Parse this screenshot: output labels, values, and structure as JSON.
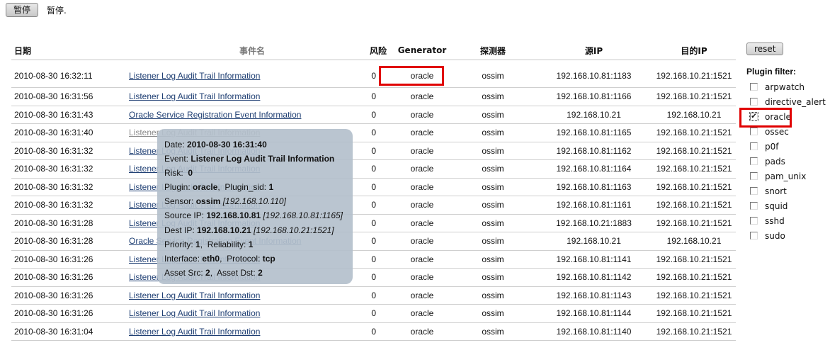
{
  "top": {
    "pause_button": "暂停",
    "pause_status": "暂停."
  },
  "table": {
    "headers": {
      "date": "日期",
      "event": "事件名",
      "risk": "风险",
      "generator": "Generator",
      "sensor": "探测器",
      "src_ip": "源IP",
      "dst_ip": "目的IP"
    },
    "rows": [
      {
        "date": "2010-08-30 16:32:11",
        "event": "Listener Log Audit Trail Information",
        "risk": "0",
        "generator": "oracle",
        "sensor": "ossim",
        "src": "192.168.10.81:1183",
        "dst": "192.168.10.21:1521"
      },
      {
        "date": "2010-08-30 16:31:56",
        "event": "Listener Log Audit Trail Information",
        "risk": "0",
        "generator": "oracle",
        "sensor": "ossim",
        "src": "192.168.10.81:1166",
        "dst": "192.168.10.21:1521"
      },
      {
        "date": "2010-08-30 16:31:43",
        "event": "Oracle Service Registration Event Information",
        "risk": "0",
        "generator": "oracle",
        "sensor": "ossim",
        "src": "192.168.10.21",
        "dst": "192.168.10.21"
      },
      {
        "date": "2010-08-30 16:31:40",
        "event": "Listener Log Audit Trail Information",
        "risk": "0",
        "generator": "oracle",
        "sensor": "ossim",
        "src": "192.168.10.81:1165",
        "dst": "192.168.10.21:1521"
      },
      {
        "date": "2010-08-30 16:31:32",
        "event": "Listener Log Audit Trail Information",
        "risk": "0",
        "generator": "oracle",
        "sensor": "ossim",
        "src": "192.168.10.81:1162",
        "dst": "192.168.10.21:1521"
      },
      {
        "date": "2010-08-30 16:31:32",
        "event": "Listener Log Audit Trail Information",
        "risk": "0",
        "generator": "oracle",
        "sensor": "ossim",
        "src": "192.168.10.81:1164",
        "dst": "192.168.10.21:1521"
      },
      {
        "date": "2010-08-30 16:31:32",
        "event": "Listener Log Audit Trail Information",
        "risk": "0",
        "generator": "oracle",
        "sensor": "ossim",
        "src": "192.168.10.81:1163",
        "dst": "192.168.10.21:1521"
      },
      {
        "date": "2010-08-30 16:31:32",
        "event": "Listener Log Audit Trail Information",
        "risk": "0",
        "generator": "oracle",
        "sensor": "ossim",
        "src": "192.168.10.81:1161",
        "dst": "192.168.10.21:1521"
      },
      {
        "date": "2010-08-30 16:31:28",
        "event": "Listener Log Audit Trail Information",
        "risk": "0",
        "generator": "oracle",
        "sensor": "ossim",
        "src": "192.168.10.21:1883",
        "dst": "192.168.10.21:1521"
      },
      {
        "date": "2010-08-30 16:31:28",
        "event": "Oracle Service Registration Event Information",
        "risk": "0",
        "generator": "oracle",
        "sensor": "ossim",
        "src": "192.168.10.21",
        "dst": "192.168.10.21"
      },
      {
        "date": "2010-08-30 16:31:26",
        "event": "Listener Log Audit Trail Information",
        "risk": "0",
        "generator": "oracle",
        "sensor": "ossim",
        "src": "192.168.10.81:1141",
        "dst": "192.168.10.21:1521"
      },
      {
        "date": "2010-08-30 16:31:26",
        "event": "Listener Log Audit Trail Information",
        "risk": "0",
        "generator": "oracle",
        "sensor": "ossim",
        "src": "192.168.10.81:1142",
        "dst": "192.168.10.21:1521"
      },
      {
        "date": "2010-08-30 16:31:26",
        "event": "Listener Log Audit Trail Information",
        "risk": "0",
        "generator": "oracle",
        "sensor": "ossim",
        "src": "192.168.10.81:1143",
        "dst": "192.168.10.21:1521"
      },
      {
        "date": "2010-08-30 16:31:26",
        "event": "Listener Log Audit Trail Information",
        "risk": "0",
        "generator": "oracle",
        "sensor": "ossim",
        "src": "192.168.10.81:1144",
        "dst": "192.168.10.21:1521"
      },
      {
        "date": "2010-08-30 16:31:04",
        "event": "Listener Log Audit Trail Information",
        "risk": "0",
        "generator": "oracle",
        "sensor": "ossim",
        "src": "192.168.10.81:1140",
        "dst": "192.168.10.21:1521"
      }
    ],
    "hovered_row_index": 3
  },
  "tooltip": {
    "date_label": "Date: ",
    "date": "2010-08-30 16:31:40",
    "event_label": "Event: ",
    "event": "Listener Log Audit Trail Information",
    "risk_label": "Risk:  ",
    "risk": "0",
    "plugin_label": "Plugin: ",
    "plugin": "oracle",
    "plugin_sid_label": ",  Plugin_sid: ",
    "plugin_sid": "1",
    "sensor_label": "Sensor: ",
    "sensor": "ossim",
    "sensor_ip": " [192.168.10.110]",
    "src_label": "Source IP: ",
    "src": "192.168.10.81",
    "src_full": " [192.168.10.81:1165]",
    "dst_label": "Dest IP: ",
    "dst": "192.168.10.21",
    "dst_full": " [192.168.10.21:1521]",
    "priority_label": "Priority: ",
    "priority": "1",
    "reliability_label": ",  Reliability: ",
    "reliability": "1",
    "interface_label": "Interface: ",
    "interface": "eth0",
    "protocol_label": ",  Protocol: ",
    "protocol": "tcp",
    "asset_src_label": "Asset Src: ",
    "asset_src": "2",
    "asset_dst_label": ",  Asset Dst: ",
    "asset_dst": "2"
  },
  "sidebar": {
    "reset_label": "reset",
    "filter_title": "Plugin filter:",
    "plugins": [
      {
        "name": "arpwatch",
        "checked": false
      },
      {
        "name": "directive_alert",
        "checked": false
      },
      {
        "name": "oracle",
        "checked": true
      },
      {
        "name": "ossec",
        "checked": false
      },
      {
        "name": "p0f",
        "checked": false
      },
      {
        "name": "pads",
        "checked": false
      },
      {
        "name": "pam_unix",
        "checked": false
      },
      {
        "name": "snort",
        "checked": false
      },
      {
        "name": "squid",
        "checked": false
      },
      {
        "name": "sshd",
        "checked": false
      },
      {
        "name": "sudo",
        "checked": false
      }
    ]
  },
  "annotation_color": "#e00000"
}
